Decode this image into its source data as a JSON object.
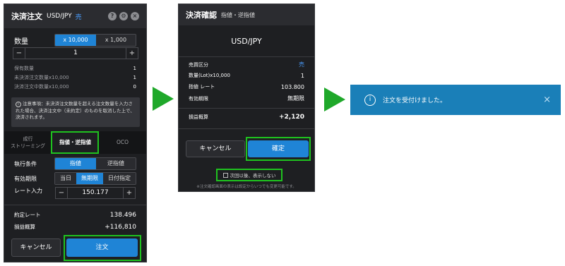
{
  "panel1": {
    "title": "決済注文",
    "pair": "USD/JPY",
    "side": "売",
    "qty_label": "数量",
    "unit_options": [
      "x 10,000",
      "x 1,000"
    ],
    "qty_value": "1",
    "minus": "−",
    "plus": "+",
    "info_rows": [
      {
        "label": "保有数量",
        "value": "1"
      },
      {
        "label": "未決済注文数量x10,000",
        "value": "1"
      },
      {
        "label": "決済注文中数量x10,000",
        "value": "0"
      }
    ],
    "notice": "注意事項：未決済注文数量を超える注文数量を入力された場合、決済注文中（未約定）のものを取消した上で、決済されます。",
    "tabs": [
      "成行\nストリーミング",
      "指値・逆指値",
      "OCO"
    ],
    "exec_label": "執行条件",
    "exec_options": [
      "指値",
      "逆指値"
    ],
    "expiry_label": "有効期限",
    "expiry_options": [
      "当日",
      "無期限",
      "日付指定"
    ],
    "rate_label": "レート入力",
    "rate_value": "150.177",
    "contract_rate_label": "約定レート",
    "contract_rate_value": "138.496",
    "pl_label": "損益概算",
    "pl_value": "+116,810",
    "cancel": "キャンセル",
    "order": "注文"
  },
  "panel2": {
    "title": "決済確認",
    "subtitle": "指値・逆指値",
    "pair": "USD/JPY",
    "rows": [
      {
        "label": "売買区分",
        "value": "売"
      },
      {
        "label": "数量(Lot)x10,000",
        "value": "1"
      },
      {
        "label": "指値 レート",
        "value": "103.800"
      },
      {
        "label": "有効期限",
        "value": "無期限"
      }
    ],
    "pl_label": "損益概算",
    "pl_value": "+2,120",
    "cancel": "キャンセル",
    "confirm": "確定",
    "checkbox_label": "次回以後、表示しない",
    "footnote": "※注文確認画面の表示は設定からいつでも変更可能です。"
  },
  "toast": {
    "message": "注文を受付けました。",
    "close": "×"
  },
  "colors": {
    "accent": "#1f84d6",
    "highlight": "#1fc21f",
    "arrow": "#1fa82a",
    "toast_bg": "#1a7fb8"
  }
}
